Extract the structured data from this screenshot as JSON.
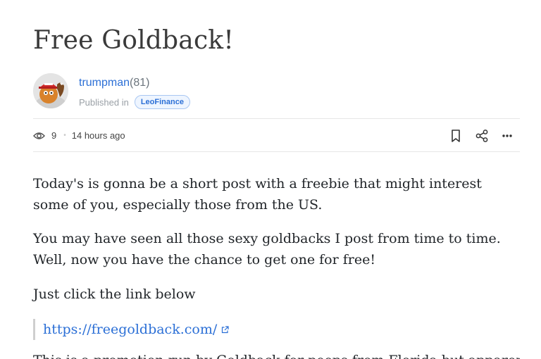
{
  "post": {
    "title": "Free Goldback!",
    "author": {
      "name": "trumpman",
      "reputation": "(81)",
      "avatar_icon": "avatar-cartoon-red-cap"
    },
    "published_label": "Published in",
    "community": "LeoFinance",
    "stats": {
      "views_icon": "eye-icon",
      "views": "9",
      "time_ago": "14 hours ago"
    },
    "actions": {
      "bookmark_icon": "bookmark-icon",
      "share_icon": "share-icon",
      "more_icon": "more-icon"
    },
    "paragraphs": [
      "Today's is gonna be a short post with a freebie that might interest some of you, especially those from the US.",
      "You may have seen all those sexy goldbacks I post from time to time. Well, now you have the chance to get one for free!",
      "Just click the link below"
    ],
    "link": {
      "text": "https://freegoldback.com/",
      "icon": "external-link-icon"
    },
    "cut_paragraph": "This is a promotion run by Goldback for peeps from Florida but apparently"
  },
  "colors": {
    "link": "#2b6fd6",
    "text": "#212529",
    "muted": "#9aa0a6",
    "badge_bg": "#eef5ff"
  }
}
